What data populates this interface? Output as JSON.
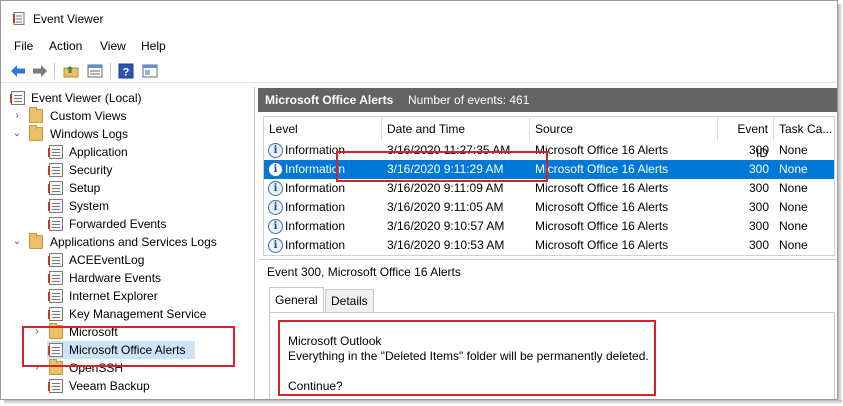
{
  "window": {
    "title": "Event Viewer"
  },
  "menu": [
    "File",
    "Action",
    "View",
    "Help"
  ],
  "toolbar": {
    "icons": [
      "back-arrow-icon",
      "forward-arrow-icon",
      "up-folder-icon",
      "properties-icon",
      "help-icon",
      "show-hide-pane-icon"
    ]
  },
  "tree": {
    "root": "Event Viewer (Local)",
    "items": [
      {
        "label": "Custom Views"
      },
      {
        "label": "Windows Logs"
      },
      {
        "label": "Application"
      },
      {
        "label": "Security"
      },
      {
        "label": "Setup"
      },
      {
        "label": "System"
      },
      {
        "label": "Forwarded Events"
      },
      {
        "label": "Applications and Services Logs"
      },
      {
        "label": "ACEEventLog"
      },
      {
        "label": "Hardware Events"
      },
      {
        "label": "Internet Explorer"
      },
      {
        "label": "Key Management Service"
      },
      {
        "label": "Microsoft"
      },
      {
        "label": "Microsoft Office Alerts"
      },
      {
        "label": "OpenSSH"
      },
      {
        "label": "Veeam Backup"
      }
    ]
  },
  "pane": {
    "title": "Microsoft Office Alerts",
    "count": "Number of events: 461"
  },
  "grid": {
    "headers": [
      "Level",
      "Date and Time",
      "Source",
      "Event ID",
      "Task Ca..."
    ],
    "rows": [
      {
        "level": "Information",
        "date": "3/16/2020 11:27:35 AM",
        "source": "Microsoft Office 16 Alerts",
        "id": "300",
        "task": "None"
      },
      {
        "level": "Information",
        "date": "3/16/2020 9:11:29 AM",
        "source": "Microsoft Office 16 Alerts",
        "id": "300",
        "task": "None"
      },
      {
        "level": "Information",
        "date": "3/16/2020 9:11:09 AM",
        "source": "Microsoft Office 16 Alerts",
        "id": "300",
        "task": "None"
      },
      {
        "level": "Information",
        "date": "3/16/2020 9:11:05 AM",
        "source": "Microsoft Office 16 Alerts",
        "id": "300",
        "task": "None"
      },
      {
        "level": "Information",
        "date": "3/16/2020 9:10:57 AM",
        "source": "Microsoft Office 16 Alerts",
        "id": "300",
        "task": "None"
      },
      {
        "level": "Information",
        "date": "3/16/2020 9:10:53 AM",
        "source": "Microsoft Office 16 Alerts",
        "id": "300",
        "task": "None"
      }
    ]
  },
  "detail": {
    "title": "Event 300, Microsoft Office 16 Alerts",
    "tabs": [
      "General",
      "Details"
    ],
    "lines": [
      "Microsoft Outlook",
      "Everything in the \"Deleted Items\" folder will be permanently deleted.",
      "",
      "Continue?"
    ]
  },
  "colors": {
    "selection": "#0078d7",
    "header": "#636363",
    "highlight": "#d6232a"
  }
}
